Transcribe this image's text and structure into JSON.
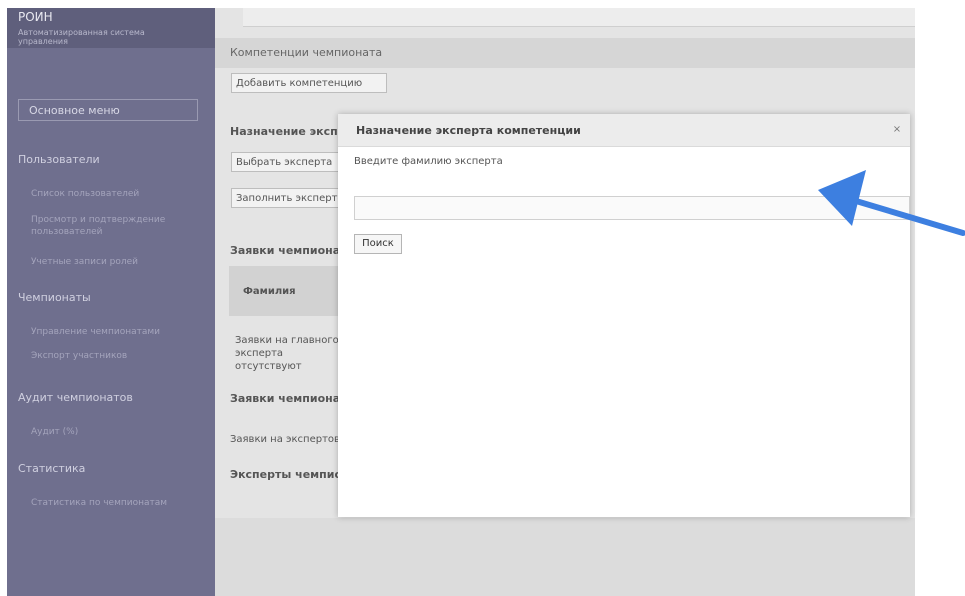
{
  "sidebar": {
    "app_title": "РОИН",
    "app_subtitle": "Автоматизированная система управления",
    "main_menu_button": "Основное меню",
    "sections": [
      {
        "title": "Пользователи",
        "items": [
          "Список пользователей",
          "Просмотр и подтверждение пользователей",
          "Учетные записи ролей"
        ]
      },
      {
        "title": "Чемпионаты",
        "items": [
          "Управление чемпионатами",
          "Экспорт участников"
        ]
      },
      {
        "title": "Аудит чемпионатов",
        "items": [
          "Аудит (%)"
        ]
      },
      {
        "title": "Статистика",
        "items": [
          "Статистика по чемпионатам"
        ]
      }
    ]
  },
  "main": {
    "page_title": "Компетенции чемпионата",
    "add_competence_button": "Добавить компетенцию",
    "assign_label": "Назначение эксперта",
    "select_expert_button": "Выбрать эксперта",
    "fill_expert_button": "Заполнить экспертов",
    "requests_title": "Заявки чемпионата",
    "surname_header": "Фамилия",
    "requests_note": "Заявки на главного эксперта отсутствуют",
    "requests_title_2": "Заявки чемпионата",
    "expert_requests_note": "Заявки на экспертов отсутствуют",
    "experts_title": "Эксперты чемпионата"
  },
  "modal": {
    "title": "Назначение эксперта компетенции",
    "close_symbol": "×",
    "label": "Введите фамилию эксперта",
    "input_value": "",
    "input_placeholder": "",
    "search_button": "Поиск"
  },
  "colors": {
    "sidebar": "#6f6f8e",
    "arrow": "#3d7fe0"
  },
  "icons": {
    "close": "close-icon",
    "annotation": "arrow-pointer-icon"
  }
}
